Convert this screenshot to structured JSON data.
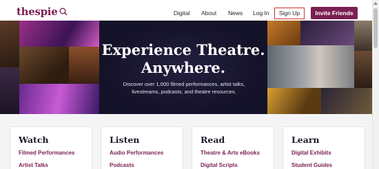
{
  "header": {
    "logo": "thespie",
    "nav": [
      "Digital",
      "About",
      "News",
      "Log In"
    ],
    "sign_up": "Sign Up",
    "invite": "Invite Friends"
  },
  "hero": {
    "title_line1": "Experience Theatre.",
    "title_line2": "Anywhere.",
    "subtitle": "Discover over 1,000 filmed performances, artist talks, livestreams, podcasts, and theatre resources."
  },
  "cards": [
    {
      "title": "Watch",
      "links": [
        "Filmed Performances",
        "Artist Talks"
      ]
    },
    {
      "title": "Listen",
      "links": [
        "Audio Performances",
        "Podcasts"
      ]
    },
    {
      "title": "Read",
      "links": [
        "Theatre & Arts eBooks",
        "Digital Scripts"
      ]
    },
    {
      "title": "Learn",
      "links": [
        "Digital Exhibits",
        "Student Guides"
      ]
    }
  ],
  "colors": {
    "brand": "#7a1f52",
    "signup_border": "#d32f2f",
    "hero_bg": "#12112a"
  }
}
